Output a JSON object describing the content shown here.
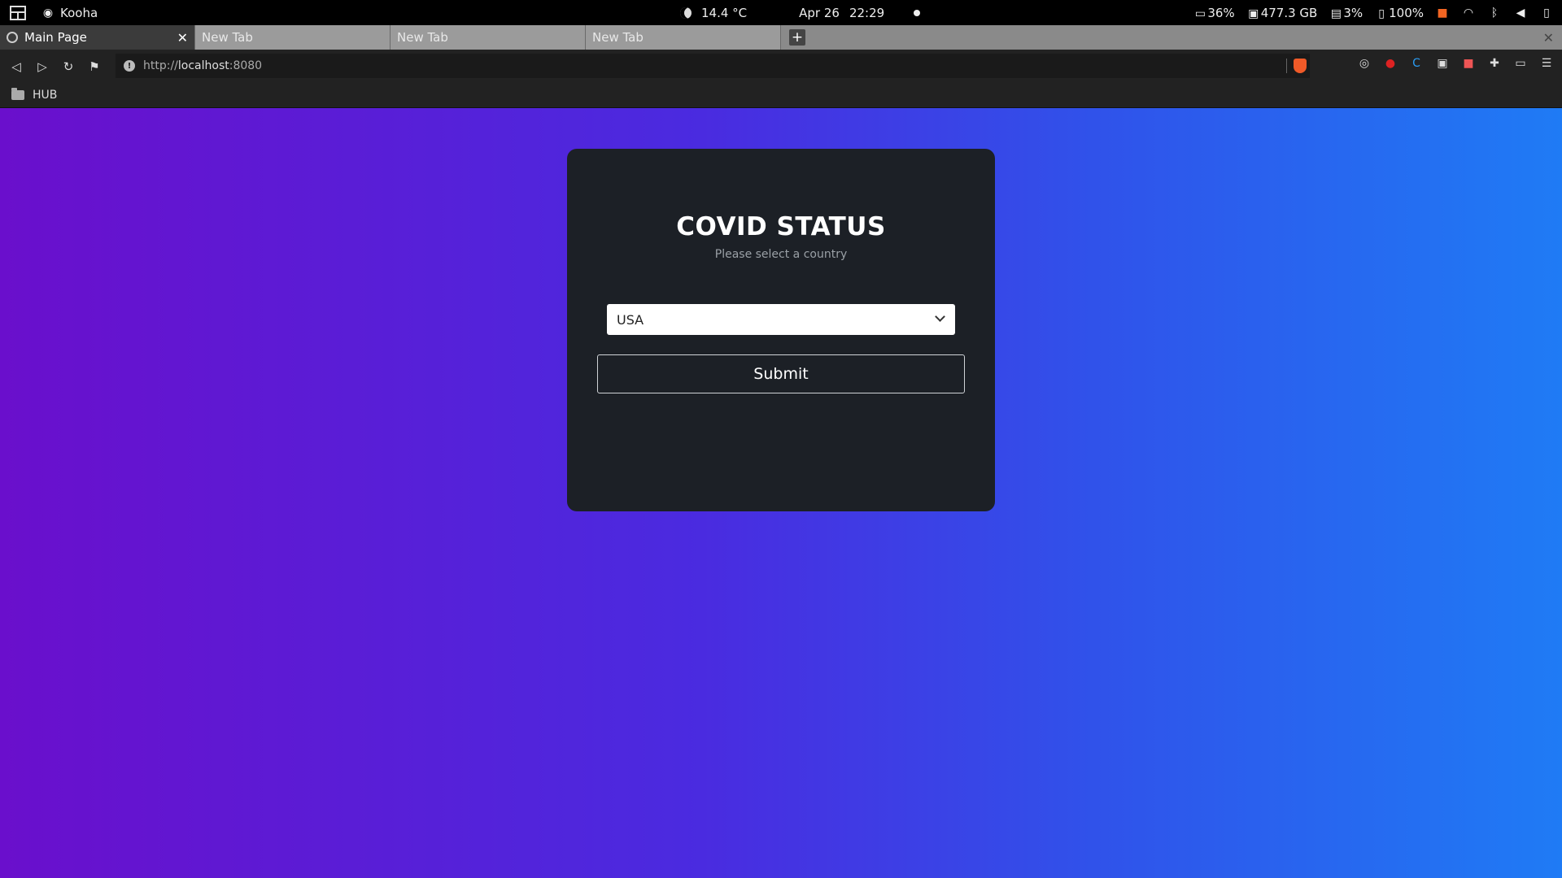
{
  "system_bar": {
    "app_name": "Kooha",
    "weather": "14.4 °C",
    "date": "Apr 26",
    "time": "22:29",
    "cpu": "36%",
    "disk": "477.3 GB",
    "memory": "3%",
    "battery": "100%"
  },
  "tabs": [
    {
      "label": "Main Page",
      "active": true
    },
    {
      "label": "New Tab",
      "active": false
    },
    {
      "label": "New Tab",
      "active": false
    },
    {
      "label": "New Tab",
      "active": false
    }
  ],
  "address_bar": {
    "prefix": "http://",
    "host": "localhost",
    "port": ":8080"
  },
  "bookmarks": [
    {
      "label": "HUB"
    }
  ],
  "card": {
    "title": "COVID STATUS",
    "subtitle": "Please select a country",
    "select_value": "USA",
    "submit_label": "Submit"
  },
  "colors": {
    "gradient_start": "#6a0fcc",
    "gradient_end": "#1f7bf5",
    "card_bg": "#1c2026"
  }
}
